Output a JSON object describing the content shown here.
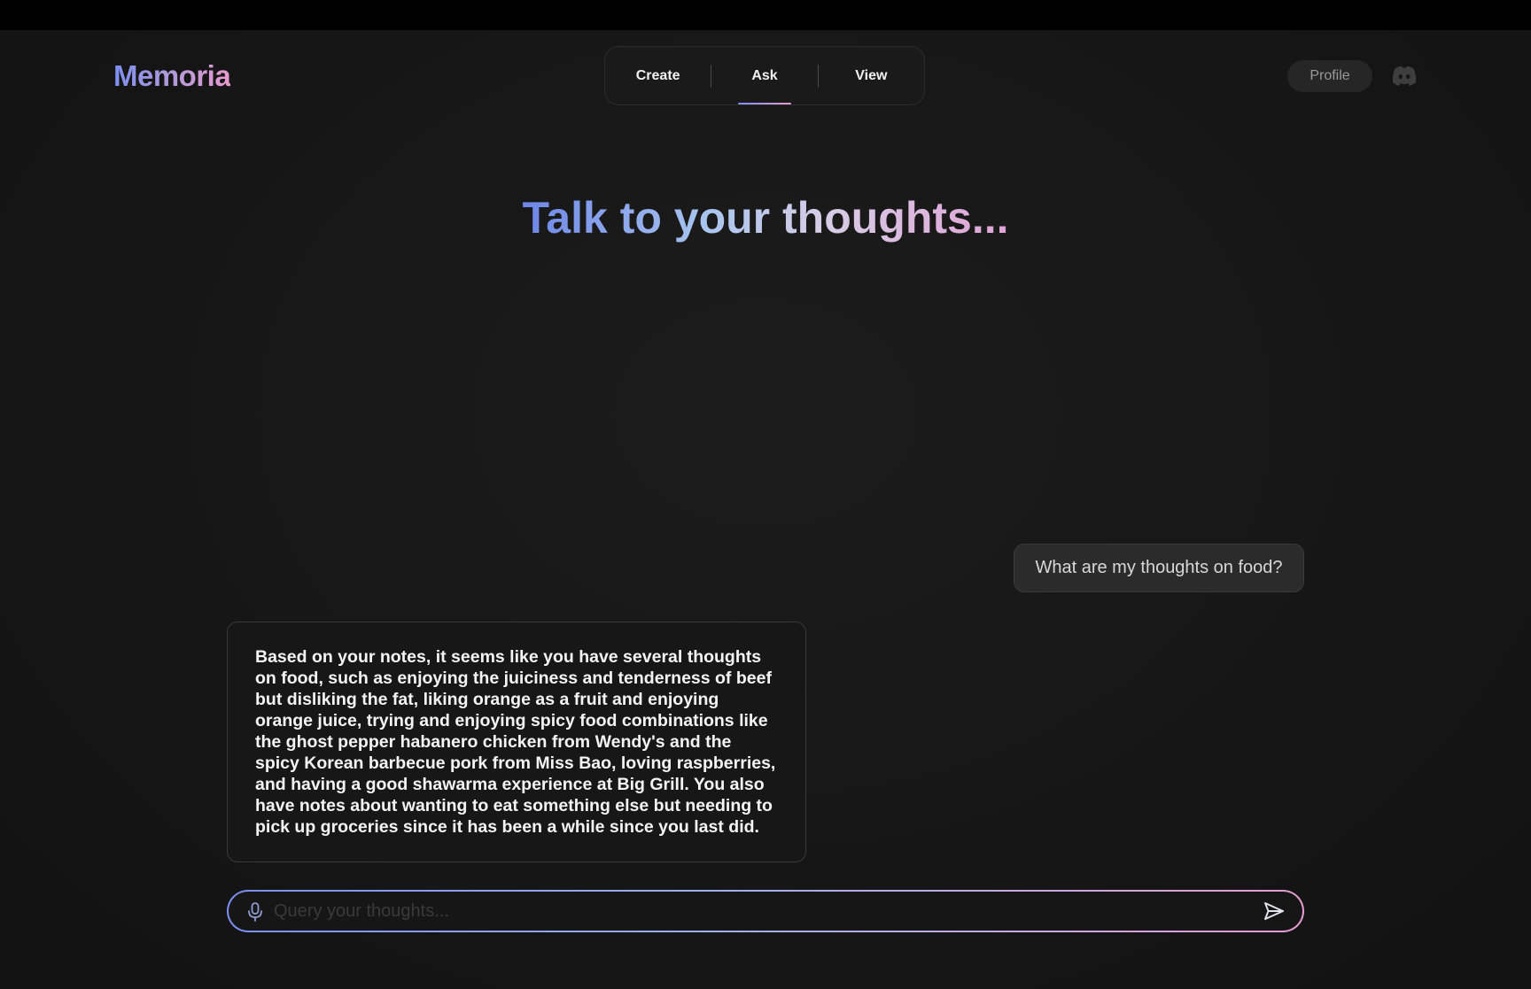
{
  "app": {
    "brand": "Memoria"
  },
  "nav": {
    "items": [
      {
        "label": "Create",
        "active": false
      },
      {
        "label": "Ask",
        "active": true
      },
      {
        "label": "View",
        "active": false
      }
    ]
  },
  "header": {
    "profile_label": "Profile",
    "discord_icon": "discord-icon"
  },
  "hero": {
    "title": "Talk to your thoughts..."
  },
  "chat": {
    "messages": [
      {
        "role": "user",
        "text": "What are my thoughts on food?"
      },
      {
        "role": "assistant",
        "text": "Based on your notes, it seems like you have several thoughts on food, such as enjoying the juiciness and tenderness of beef but disliking the fat, liking orange as a fruit and enjoying orange juice, trying and enjoying spicy food combinations like the ghost pepper habanero chicken from Wendy's and the spicy Korean barbecue pork from Miss Bao, loving raspberries, and having a good shawarma experience at Big Grill. You also have notes about wanting to eat something else but needing to pick up groceries since it has been a while since you last did."
      }
    ]
  },
  "query": {
    "placeholder": "Query your thoughts...",
    "value": ""
  },
  "colors": {
    "accent_start": "#7b8ff0",
    "accent_end": "#e69bd0",
    "background": "#161616"
  }
}
